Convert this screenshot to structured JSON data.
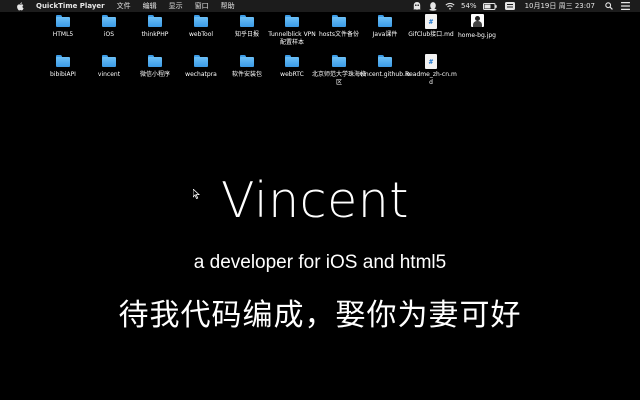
{
  "menubar": {
    "app_name": "QuickTime Player",
    "menus": [
      "文件",
      "编辑",
      "显示",
      "窗口",
      "帮助"
    ],
    "battery": "54%",
    "clock": "10月19日 周三  23:07",
    "icons": [
      "apple-icon",
      "ghost-icon",
      "qq-icon",
      "wifi-icon",
      "battery-icon",
      "keyboard-icon",
      "search-icon",
      "list-icon"
    ]
  },
  "desktop_icons": [
    {
      "label": "HTML5",
      "type": "folder"
    },
    {
      "label": "iOS",
      "type": "folder"
    },
    {
      "label": "thinkPHP",
      "type": "folder"
    },
    {
      "label": "webTool",
      "type": "folder"
    },
    {
      "label": "知乎日报",
      "type": "folder"
    },
    {
      "label": "Tunnelblick VPN 配置样本",
      "type": "folder"
    },
    {
      "label": "hosts文件备份",
      "type": "folder"
    },
    {
      "label": "Java课件",
      "type": "folder"
    },
    {
      "label": "GifClub接口.md",
      "type": "markdown"
    },
    {
      "label": "home-bg.jpg",
      "type": "image"
    },
    {
      "label": "bibibiAPI",
      "type": "folder"
    },
    {
      "label": "vincent",
      "type": "folder"
    },
    {
      "label": "微信小程序",
      "type": "folder"
    },
    {
      "label": "wechatpra",
      "type": "folder"
    },
    {
      "label": "软件安装包",
      "type": "folder"
    },
    {
      "label": "webRTC",
      "type": "folder"
    },
    {
      "label": "北京师范大学珠海校区",
      "type": "folder"
    },
    {
      "label": "vincent.github.io",
      "type": "folder"
    },
    {
      "label": "Readme_zh-cn.md",
      "type": "markdown"
    }
  ],
  "content": {
    "title": "Vincent",
    "subtitle": "a developer for iOS and html5",
    "slogan": "待我代码编成，娶你为妻可好"
  }
}
